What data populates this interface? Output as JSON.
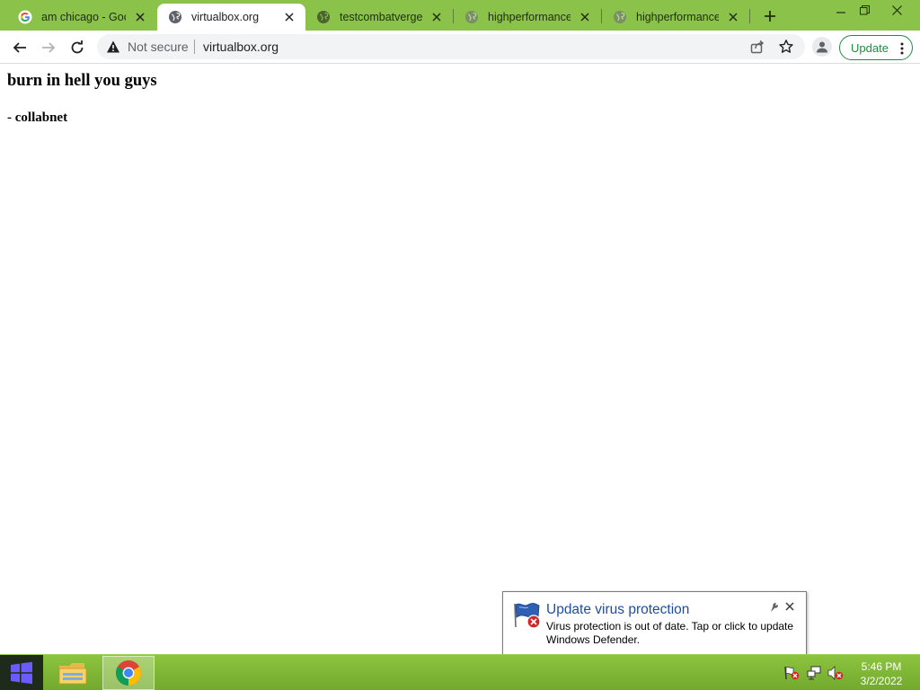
{
  "browser": {
    "tabs": [
      {
        "title": "am chicago - Goog",
        "favicon": "google-g-icon",
        "active": false
      },
      {
        "title": "virtualbox.org",
        "favicon": "globe-icon",
        "active": true
      },
      {
        "title": "testcombatverge.c",
        "favicon": "globe-icon",
        "active": false
      },
      {
        "title": "highperformanced",
        "favicon": "globe-icon",
        "active": false
      },
      {
        "title": "highperformanced",
        "favicon": "globe-icon",
        "active": false
      }
    ],
    "security_label": "Not secure",
    "url": "virtualbox.org",
    "update_label": "Update"
  },
  "page": {
    "heading": "burn in hell you guys",
    "signature": "- collabnet"
  },
  "notification": {
    "title": "Update virus protection",
    "body": "Virus protection is out of date. Tap or click to update Windows Defender.",
    "icon": "defender-flag-error-icon"
  },
  "taskbar": {
    "pinned": [
      "file-explorer-icon",
      "chrome-icon"
    ],
    "tray_icons": [
      "action-center-error-icon",
      "network-icon",
      "volume-muted-icon"
    ],
    "time": "5:46 PM",
    "date": "3/2/2022"
  },
  "colors": {
    "chrome_frame": "#8bc34a",
    "taskbar": "#7cb335",
    "update_green": "#1e8e3e",
    "notification_title": "#1e4e9a"
  }
}
